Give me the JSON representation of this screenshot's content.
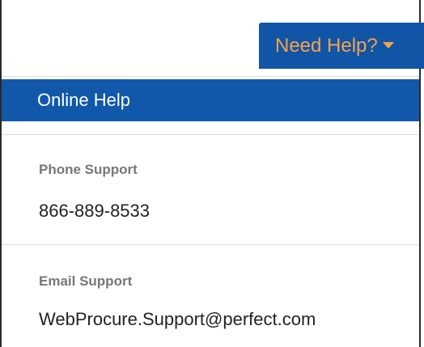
{
  "help_menu": {
    "button_label": "Need Help?",
    "button_caret_icon": "caret-down-icon",
    "items": [
      {
        "label": "Online Help",
        "active": true
      }
    ],
    "sections": [
      {
        "header": "Phone Support",
        "value": "866-889-8533"
      },
      {
        "header": "Email Support",
        "value": "WebProcure.Support@perfect.com"
      }
    ]
  },
  "colors": {
    "button_bg": "#1155a6",
    "button_text": "#f5a24a",
    "active_item_bg": "#1158ab",
    "active_item_text": "#ffffff",
    "section_header_text": "#777777",
    "section_value_text": "#222222",
    "divider": "#dcdcdc"
  }
}
